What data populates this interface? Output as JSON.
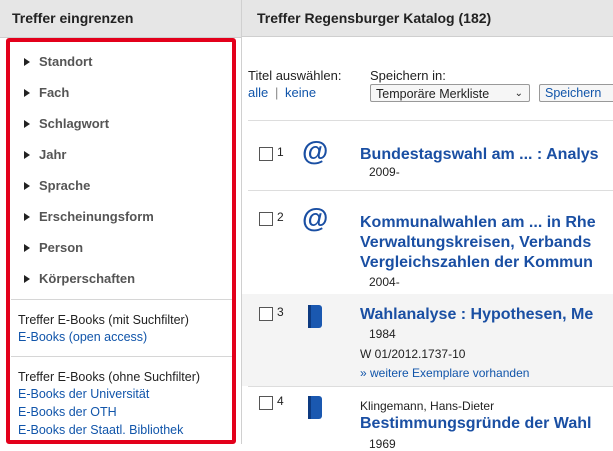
{
  "facets": {
    "header": "Treffer eingrenzen",
    "items": [
      "Standort",
      "Fach",
      "Schlagwort",
      "Jahr",
      "Sprache",
      "Erscheinungsform",
      "Person",
      "Körperschaften"
    ],
    "ebooks_filtered_label": "Treffer E-Books (mit Suchfilter)",
    "ebooks_filtered_links": [
      "E-Books (open access)"
    ],
    "ebooks_unfiltered_label": "Treffer E-Books (ohne Suchfilter)",
    "ebooks_unfiltered_links": [
      "E-Books der Universität",
      "E-Books der OTH",
      "E-Books der Staatl. Bibliothek"
    ],
    "highlight_color": "#e3001b"
  },
  "results": {
    "header": "Treffer Regensburger Katalog (182)",
    "select_titles_label": "Titel auswählen:",
    "select_all": "alle",
    "select_separator": "|",
    "select_none": "keine",
    "save_in_label": "Speichern in:",
    "save_target": "Temporäre Merkliste",
    "save_button": "Speichern",
    "items": [
      {
        "num": "1",
        "icon": "at-sign-icon",
        "title_lines": [
          "Bundestagswahl am ... : Analys"
        ],
        "year": "2009-"
      },
      {
        "num": "2",
        "icon": "at-sign-icon",
        "title_lines": [
          "Kommunalwahlen am ... in Rhe",
          "Verwaltungskreisen, Verbands",
          "Vergleichszahlen der Kommun"
        ],
        "year": "2004-"
      },
      {
        "num": "3",
        "icon": "book-icon",
        "title_lines": [
          "Wahlanalyse : Hypothesen, Me"
        ],
        "year": "1984",
        "signature": "W 01/2012.1737-10",
        "more": "» weitere Exemplare vorhanden"
      },
      {
        "num": "4",
        "icon": "book-icon",
        "author": "Klingemann, Hans-Dieter",
        "title_lines": [
          "Bestimmungsgründe der Wahl"
        ],
        "year": "1969"
      }
    ]
  }
}
